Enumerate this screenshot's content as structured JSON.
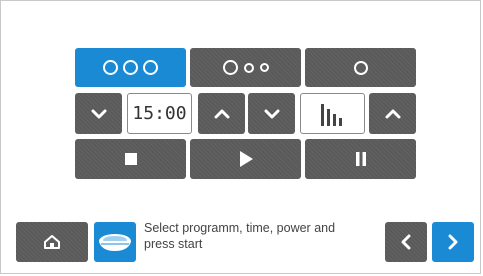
{
  "programs": {
    "items": [
      {
        "name": "program-1",
        "circles": 3,
        "active": true
      },
      {
        "name": "program-2",
        "circles": 3,
        "active": false
      },
      {
        "name": "program-3",
        "circles": 1,
        "active": false
      }
    ]
  },
  "timer": {
    "display": "15:00"
  },
  "power": {
    "icon": "power-bars-icon"
  },
  "controls": {
    "stop_icon": "stop-icon",
    "start_icon": "play-icon",
    "pause_icon": "pause-icon"
  },
  "footer": {
    "message": "Select programm, time, power and press start",
    "home_icon": "home-icon",
    "appliance_icon": "pan-icon",
    "prev_icon": "chevron-left-icon",
    "next_icon": "chevron-right-icon"
  },
  "colors": {
    "accent": "#1a8ad4",
    "button": "#5a5a5a",
    "text": "#444444"
  }
}
